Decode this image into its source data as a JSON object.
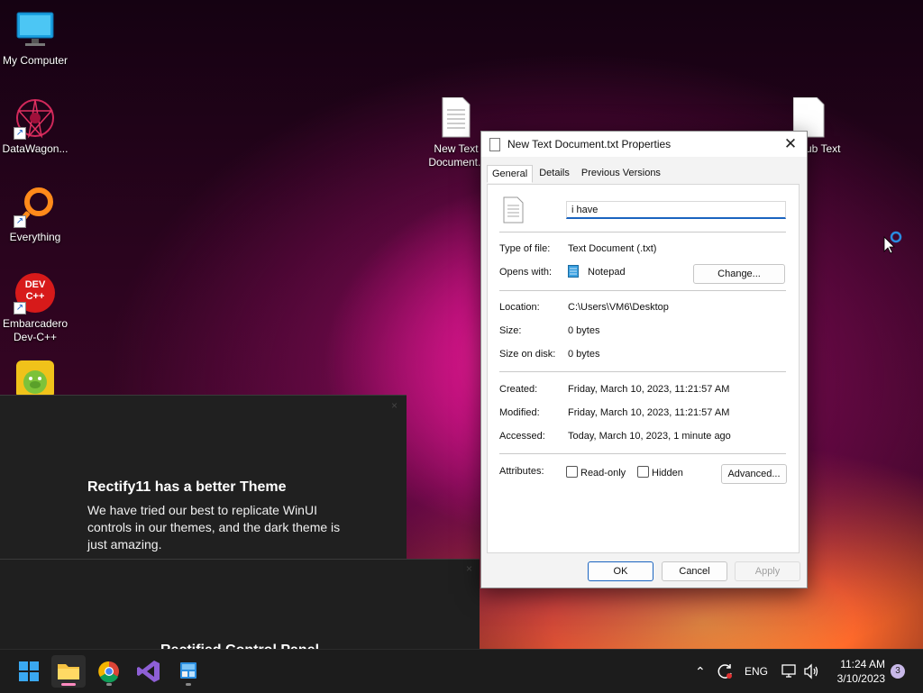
{
  "desktop": {
    "icons": [
      {
        "label": "My Computer"
      },
      {
        "label": "DataWagon..."
      },
      {
        "label": "Everything"
      },
      {
        "label": "Embarcadero Dev-C++",
        "logo_text": "DEV C++"
      },
      {
        "label": "New Text Document.t"
      },
      {
        "label": "ub Text"
      }
    ]
  },
  "dialog": {
    "title": "New Text Document.txt Properties",
    "tabs": [
      {
        "label": "General",
        "active": true
      },
      {
        "label": "Details",
        "active": false
      },
      {
        "label": "Previous Versions",
        "active": false
      }
    ],
    "name_value": "i have",
    "type_label": "Type of file:",
    "type_value": "Text Document (.txt)",
    "opens_label": "Opens with:",
    "opens_value": "Notepad",
    "change_label": "Change...",
    "location_label": "Location:",
    "location_value": "C:\\Users\\VM6\\Desktop",
    "size_label": "Size:",
    "size_value": "0 bytes",
    "size_disk_label": "Size on disk:",
    "size_disk_value": "0 bytes",
    "created_label": "Created:",
    "created_value": "Friday, March 10, 2023, 11:21:57 AM",
    "modified_label": "Modified:",
    "modified_value": "Friday, March 10, 2023, 11:21:57 AM",
    "accessed_label": "Accessed:",
    "accessed_value": "Today, March 10, 2023, 1 minute ago",
    "attributes_label": "Attributes:",
    "readonly_label": "Read-only",
    "hidden_label": "Hidden",
    "advanced_label": "Advanced...",
    "ok_label": "OK",
    "cancel_label": "Cancel",
    "apply_label": "Apply"
  },
  "banner": {
    "title": "Rectify11 has a better Theme",
    "text": "We have tried our best to replicate WinUI controls in our themes, and the dark theme is just amazing.",
    "partial_text": "Rectified Control Panel"
  },
  "taskbar": {
    "language": "ENG",
    "time": "11:24 AM",
    "date": "3/10/2023",
    "notification_count": "3"
  },
  "colors": {
    "accent": "#1a64c0",
    "dark_panel": "#202020",
    "taskbar": "#1c1c1c"
  }
}
